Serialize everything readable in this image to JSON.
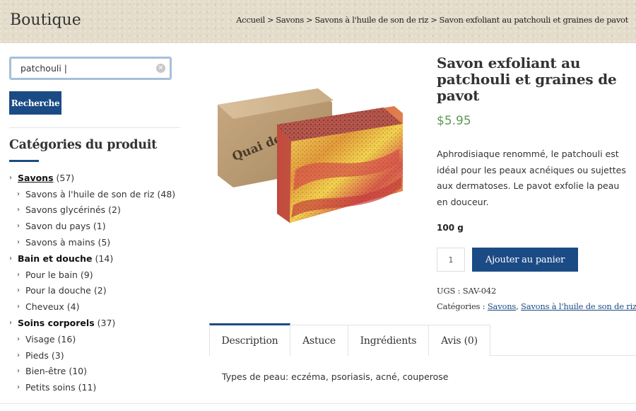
{
  "header": {
    "site_title": "Boutique",
    "breadcrumb": [
      "Accueil",
      "Savons",
      "Savons à l'huile de son de riz",
      "Savon exfoliant au patchouli et graines de pavot"
    ],
    "separator": ">"
  },
  "sidebar": {
    "search": {
      "value": "patchouli |",
      "clear_icon": "clear-circle-icon",
      "button_label": "Recherche"
    },
    "categories_heading": "Catégories du produit",
    "categories": [
      {
        "name": "Savons",
        "count": "(57)",
        "level": 0
      },
      {
        "name": "Savons à l'huile de son de riz",
        "count": "(48)",
        "level": 1
      },
      {
        "name": "Savons glycérinés",
        "count": "(2)",
        "level": 1
      },
      {
        "name": "Savon du pays",
        "count": "(1)",
        "level": 1
      },
      {
        "name": "Savons à mains",
        "count": "(5)",
        "level": 1
      },
      {
        "name": "Bain et douche",
        "count": "(14)",
        "level": 0
      },
      {
        "name": "Pour le bain",
        "count": "(9)",
        "level": 1
      },
      {
        "name": "Pour la douche",
        "count": "(2)",
        "level": 1
      },
      {
        "name": "Cheveux",
        "count": "(4)",
        "level": 1
      },
      {
        "name": "Soins corporels",
        "count": "(37)",
        "level": 0
      },
      {
        "name": "Visage",
        "count": "(16)",
        "level": 1
      },
      {
        "name": "Pieds",
        "count": "(3)",
        "level": 1
      },
      {
        "name": "Bien-être",
        "count": "(10)",
        "level": 1
      },
      {
        "name": "Petits soins",
        "count": "(11)",
        "level": 1
      }
    ]
  },
  "product": {
    "title": "Savon exfoliant au patchouli et graines de pavot",
    "price": "$5.95",
    "description": "Aphrodisiaque renommé, le patchouli est idéal pour les peaux acnéiques ou sujettes aux dermatoses. Le pavot exfolie la peau en douceur.",
    "weight": "100 g",
    "quantity": "1",
    "add_to_cart_label": "Ajouter au panier",
    "sku_label": "UGS :",
    "sku": "SAV-042",
    "categories_label": "Catégories :",
    "categories": [
      "Savons",
      "Savons à l'huile de son de riz"
    ],
    "box_text": "Quai des Bulles"
  },
  "tabs": [
    {
      "label": "Description",
      "active": true
    },
    {
      "label": "Astuce",
      "active": false
    },
    {
      "label": "Ingrédients",
      "active": false
    },
    {
      "label": "Avis (0)",
      "active": false
    }
  ],
  "tab_content": "Types de peau: eczéma, psoriasis, acné, couperose",
  "colors": {
    "accent": "#1b4b85",
    "price": "#5b9a52",
    "header_bg": "#e4dccb"
  }
}
